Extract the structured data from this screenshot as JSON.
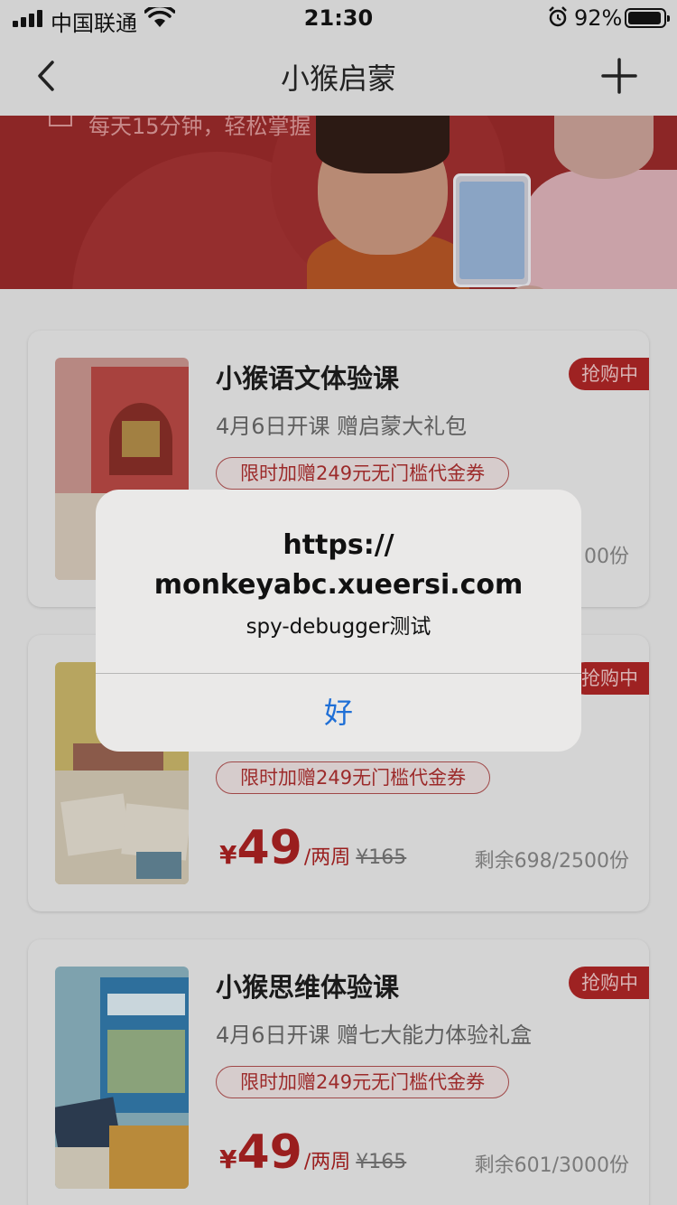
{
  "status_bar": {
    "carrier": "中国联通",
    "time": "21:30",
    "battery_percent": "92%",
    "signal_bars": 4
  },
  "nav": {
    "title": "小猴启蒙",
    "back_icon": "chevron-left-icon",
    "add_icon": "plus-icon"
  },
  "banner": {
    "text": "每天15分钟，轻松掌握"
  },
  "courses": [
    {
      "title": "小猴语文体验课",
      "subtitle": "4月6日开课  赠启蒙大礼包",
      "badge": "抢购中",
      "coupon": "限时加赠249元无门槛代金券",
      "stock_partial": "00份"
    },
    {
      "badge": "抢购中",
      "coupon": "限时加赠249无门槛代金券",
      "currency": "¥",
      "price": "49",
      "unit": "/两周",
      "original_price": "¥165",
      "stock": "剩余698/2500份"
    },
    {
      "title": "小猴思维体验课",
      "subtitle": "4月6日开课  赠七大能力体验礼盒",
      "badge": "抢购中",
      "coupon": "限时加赠249元无门槛代金券",
      "currency": "¥",
      "price": "49",
      "unit": "/两周",
      "original_price": "¥165",
      "stock": "剩余601/3000份"
    }
  ],
  "alert": {
    "title_line1": "https://",
    "title_line2": "monkeyabc.xueersi.com",
    "message": "spy-debugger测试",
    "ok_button": "好"
  },
  "colors": {
    "brand_red": "#c62f2f",
    "link_blue": "#1f6fd6"
  }
}
